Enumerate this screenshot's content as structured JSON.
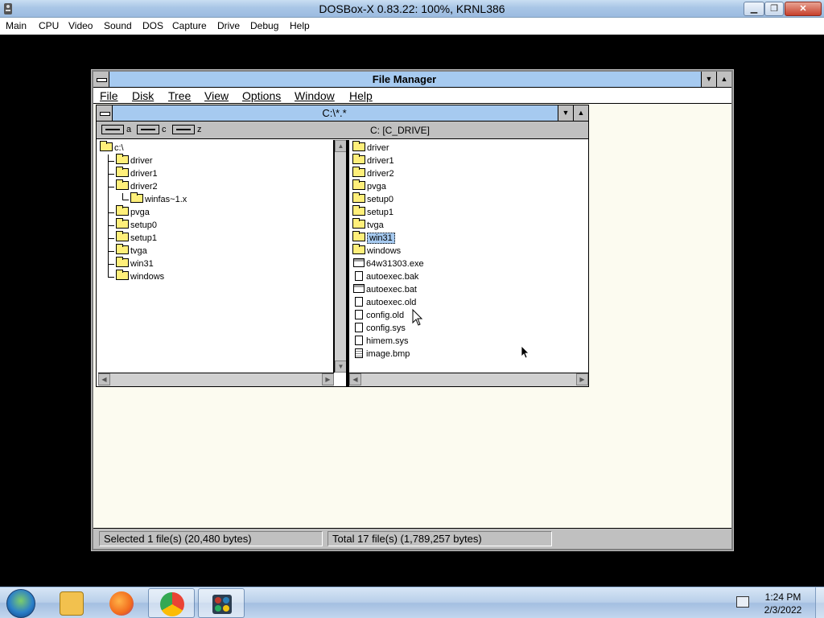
{
  "host": {
    "title": "DOSBox-X 0.83.22: 100%, KRNL386",
    "menu": [
      "Main",
      "CPU",
      "Video",
      "Sound",
      "DOS",
      "Capture",
      "Drive",
      "Debug",
      "Help"
    ]
  },
  "file_manager": {
    "title": "File Manager",
    "menu": [
      "File",
      "Disk",
      "Tree",
      "View",
      "Options",
      "Window",
      "Help"
    ],
    "directory_window": {
      "title": "C:\\*.*",
      "drives": [
        "a",
        "c",
        "z"
      ],
      "volume_label": "C: [C_DRIVE]",
      "tree": {
        "root": "c:\\",
        "items": [
          {
            "name": "driver",
            "level": 1
          },
          {
            "name": "driver1",
            "level": 1
          },
          {
            "name": "driver2",
            "level": 1
          },
          {
            "name": "winfas~1.x",
            "level": 2
          },
          {
            "name": "pvga",
            "level": 1
          },
          {
            "name": "setup0",
            "level": 1
          },
          {
            "name": "setup1",
            "level": 1
          },
          {
            "name": "tvga",
            "level": 1
          },
          {
            "name": "win31",
            "level": 1
          },
          {
            "name": "windows",
            "level": 1
          }
        ]
      },
      "files": [
        {
          "name": "driver",
          "type": "folder"
        },
        {
          "name": "driver1",
          "type": "folder"
        },
        {
          "name": "driver2",
          "type": "folder"
        },
        {
          "name": "pvga",
          "type": "folder"
        },
        {
          "name": "setup0",
          "type": "folder"
        },
        {
          "name": "setup1",
          "type": "folder"
        },
        {
          "name": "tvga",
          "type": "folder"
        },
        {
          "name": "win31",
          "type": "folder",
          "selected": true
        },
        {
          "name": "windows",
          "type": "folder"
        },
        {
          "name": "64w31303.exe",
          "type": "exe"
        },
        {
          "name": "autoexec.bak",
          "type": "file"
        },
        {
          "name": "autoexec.bat",
          "type": "exe"
        },
        {
          "name": "autoexec.old",
          "type": "file"
        },
        {
          "name": "config.old",
          "type": "file"
        },
        {
          "name": "config.sys",
          "type": "file"
        },
        {
          "name": "himem.sys",
          "type": "file"
        },
        {
          "name": "image.bmp",
          "type": "doc"
        }
      ]
    },
    "status": {
      "selected": "Selected 1 file(s) (20,480 bytes)",
      "total": "Total 17 file(s) (1,789,257 bytes)"
    }
  },
  "taskbar": {
    "apps": [
      {
        "icon": "file-explorer-icon",
        "color": "#f2c14e"
      },
      {
        "icon": "firefox-icon",
        "color": "#f26b1d"
      },
      {
        "icon": "chrome-icon",
        "color": "#34a853"
      },
      {
        "icon": "dosbox-icon",
        "color": "#c0392b",
        "active": true
      }
    ],
    "clock_time": "1:24 PM",
    "clock_date": "2/3/2022"
  }
}
